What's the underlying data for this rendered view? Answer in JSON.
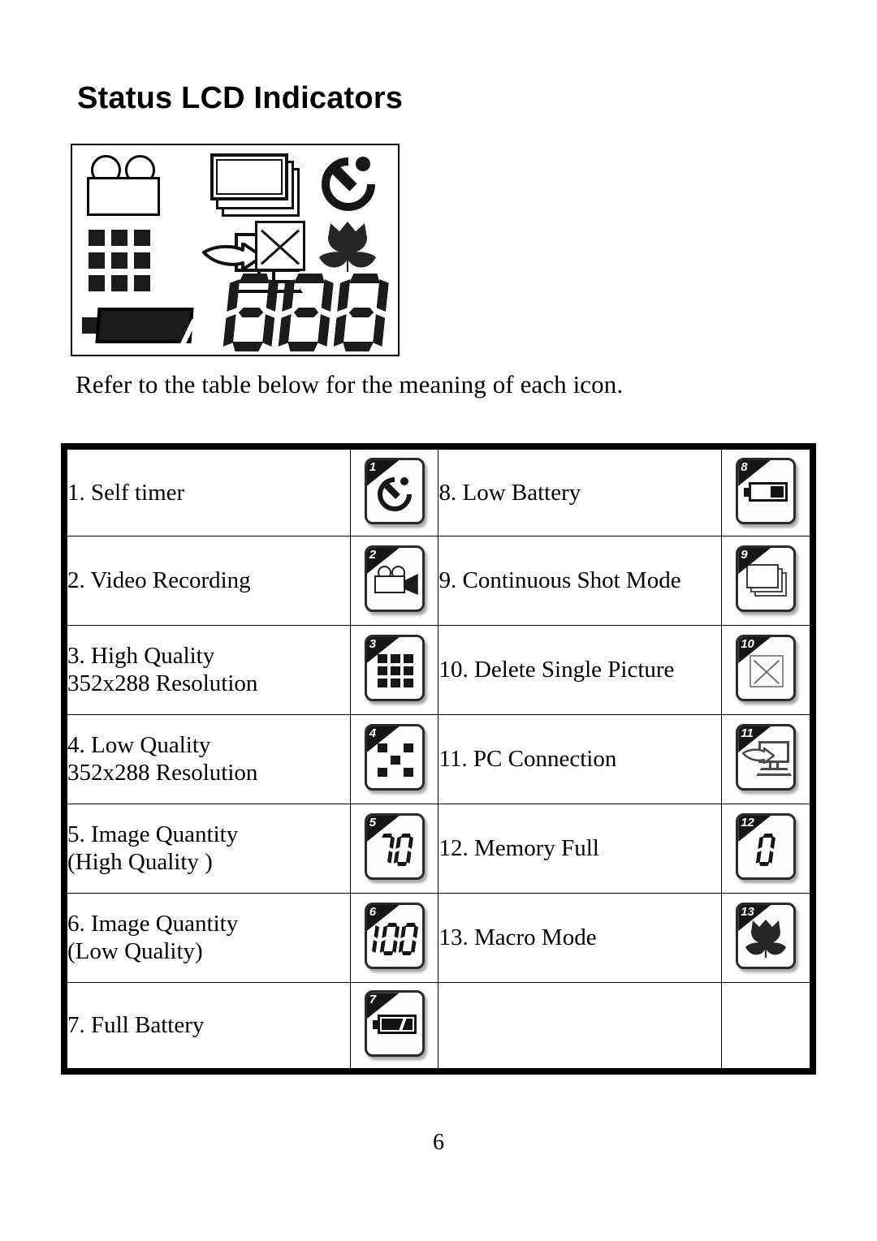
{
  "page": {
    "title": "Status LCD Indicators",
    "caption": "Refer to the table below for the meaning of each icon.",
    "page_number": "6"
  },
  "lcd_panel": {
    "digits": "888",
    "icons": [
      "video-camera-icon",
      "stacked-photos-icon",
      "self-timer-icon",
      "quality-grid-icon",
      "pc-connection-icon",
      "delete-picture-icon",
      "macro-flower-icon",
      "battery-icon",
      "seven-segment-counter"
    ]
  },
  "table": {
    "rows": [
      {
        "left": {
          "number": "1.",
          "label": "Self timer",
          "label_line2": "",
          "icon_number": "1",
          "icon": "self-timer-icon"
        },
        "right": {
          "number": "8.",
          "label": "Low Battery",
          "label_line2": "",
          "icon_number": "8",
          "icon": "low-battery-icon"
        }
      },
      {
        "left": {
          "number": "2.",
          "label": "Video Recording",
          "label_line2": "",
          "icon_number": "2",
          "icon": "video-camera-icon"
        },
        "right": {
          "number": "9.",
          "label": "Continuous Shot Mode",
          "label_line2": "",
          "icon_number": "9",
          "icon": "continuous-shot-icon"
        }
      },
      {
        "left": {
          "number": "3.",
          "label": "High Quality",
          "label_line2": "352x288 Resolution",
          "icon_number": "3",
          "icon": "high-quality-grid-icon"
        },
        "right": {
          "number": "10.",
          "label": "Delete Single Picture",
          "label_line2": "",
          "icon_number": "10",
          "icon": "delete-picture-icon"
        }
      },
      {
        "left": {
          "number": "4.",
          "label": "Low Quality",
          "label_line2": "352x288 Resolution",
          "icon_number": "4",
          "icon": "low-quality-dots-icon"
        },
        "right": {
          "number": "11.",
          "label": "PC Connection",
          "label_line2": "",
          "icon_number": "11",
          "icon": "pc-connection-icon"
        }
      },
      {
        "left": {
          "number": "5.",
          "label": "Image Quantity",
          "label_line2": "(High Quality )",
          "icon_number": "5",
          "icon": "counter-70-icon",
          "icon_value": "70"
        },
        "right": {
          "number": "12.",
          "label": "Memory Full",
          "label_line2": "",
          "icon_number": "12",
          "icon": "counter-0-icon",
          "icon_value": "0"
        }
      },
      {
        "left": {
          "number": "6.",
          "label": "Image Quantity",
          "label_line2": "(Low Quality)",
          "icon_number": "6",
          "icon": "counter-100-icon",
          "icon_value": "100"
        },
        "right": {
          "number": "13.",
          "label": "Macro Mode",
          "label_line2": "",
          "icon_number": "13",
          "icon": "macro-flower-icon"
        }
      },
      {
        "left": {
          "number": "7.",
          "label": "Full Battery",
          "label_line2": "",
          "icon_number": "7",
          "icon": "full-battery-icon"
        },
        "right": {
          "number": "",
          "label": "",
          "label_line2": "",
          "icon_number": "",
          "icon": ""
        }
      }
    ]
  },
  "colors": {
    "ink": "#000000",
    "paper": "#ffffff",
    "icon_dark": "#1b1b1b",
    "badge_border": "#2a2a2a"
  }
}
